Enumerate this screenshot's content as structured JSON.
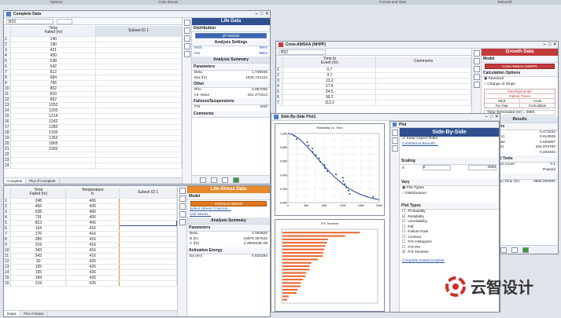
{
  "menubar": {
    "items": [
      "Options",
      "Folio Sheets",
      "",
      "Format and View",
      "ReliaSoft"
    ]
  },
  "win1": {
    "title": "Complete Data",
    "cell_ref": "B33",
    "headers": [
      "Time\nFailed (hr)",
      "Subset ID 1"
    ],
    "rows": [
      "140",
      "190",
      "421",
      "450",
      "538",
      "542",
      "612",
      "684",
      "706",
      "802",
      "810",
      "862",
      "1052",
      "1202",
      "1214",
      "1242",
      "1282",
      "1330",
      "1352",
      "1865",
      "2303"
    ],
    "tabs": [
      "Complete",
      "Plot of Complete"
    ],
    "panel": {
      "title": "Life Data",
      "distribution_label": "Distribution",
      "distribution": "2P-Weibull",
      "analysis_settings": "Analysis Settings",
      "opts": [
        "RRX",
        "RRY",
        "MLE",
        "FM",
        "MED"
      ],
      "opts_row1": [
        "RRX",
        "RRY"
      ],
      "opts_row2": [
        "FM",
        "MED"
      ],
      "summary": "Analysis Summary",
      "params": "Parameters",
      "kv": [
        [
          "Beta",
          "1.735945"
        ],
        [
          "Eta (hr)",
          "1026.721224"
        ]
      ],
      "other": "Other",
      "kv2": [
        [
          "Rho",
          "0.987065"
        ],
        [
          "LK Value",
          "-151.471814"
        ]
      ],
      "fs": "Failures/Suspensions",
      "fs_row": [
        "F/S",
        "20/0"
      ],
      "comments": "Comments"
    }
  },
  "win2": {
    "cell_ref": "B52",
    "headers": [
      "Time to\nEvent (hr)",
      "Comments"
    ],
    "rows": [
      "0.7",
      "3.7",
      "13.2",
      "17.6",
      "54.5",
      "99.2",
      "112.2"
    ],
    "panel": {
      "title": "Growth Data",
      "model_label": "Model",
      "model": "Crow-AMSAA (NHPP)",
      "calc": "Calculation Options",
      "opt1": "Standard",
      "opt2": "Change of Slope",
      "dev": "Developmental",
      "ft": "Failure Times",
      "grid": [
        "MLE",
        "Crow",
        "No Gap",
        "Cumulative"
      ],
      "term": "Time Terminated (hr) = 3860",
      "results": "Results",
      "params": "Parameters",
      "kv": [
        [
          "Beta",
          "0.472033"
        ],
        [
          "Lambda (hr)",
          "0.613926"
        ],
        [
          "Growth Rate",
          "0.526967"
        ],
        [
          "DMTBF (hr)",
          "284.976700"
        ],
        [
          "DFI",
          "0.003404"
        ]
      ],
      "stat": "Statistical Tests",
      "kv2": [
        [
          "Significance Level",
          "0.1"
        ],
        [
          "CVM",
          "Passed"
        ]
      ],
      "other": "Other",
      "term2": "Termination Time (hr)",
      "term2v": "3860.000000"
    }
  },
  "win3": {
    "title": "Life-Stress Data",
    "headers": [
      "Time\nFailed (hr)",
      "Temperature\nK",
      "Subset ID 1"
    ],
    "rows": [
      [
        "248",
        "406"
      ],
      [
        "456",
        "406"
      ],
      [
        "528",
        "406"
      ],
      [
        "731",
        "406"
      ],
      [
        "813",
        "406"
      ],
      [
        "164",
        "416"
      ],
      [
        "176",
        "416"
      ],
      [
        "289",
        "416"
      ],
      [
        "319",
        "416"
      ],
      [
        "343",
        "416"
      ],
      [
        "543",
        "416"
      ],
      [
        "92",
        "426"
      ],
      [
        "105",
        "426"
      ],
      [
        "155",
        "426"
      ],
      [
        "184",
        "426"
      ],
      [
        "219",
        "426"
      ]
    ],
    "tabs": [
      "Data1",
      "Plot of Data1"
    ],
    "panel": {
      "title": "Life-Stress Data",
      "model_label": "Model",
      "model": "Arrhenius-Weibull",
      "links": [
        "Select Stress Columns...",
        "Use Stress..."
      ],
      "summary": "Analysis Summary",
      "params": "Parameters",
      "kv": [
        [
          "Beta",
          "2.063820"
        ],
        [
          "B (K)",
          "10679.357542"
        ],
        [
          "C (hr)",
          "2.396615E-09"
        ]
      ],
      "act": "Activation Energy",
      "act_row": [
        "Ea (eV)",
        "0.920294"
      ]
    }
  },
  "win4": {
    "title": "Side-By-Side Plot1",
    "plot1": {
      "title": "Reliability vs. Time",
      "yvals": [
        "1.000",
        "0.800",
        "0.600",
        "0.400",
        "0.200",
        "0.000"
      ],
      "xvals": [
        "0",
        "400",
        "800",
        "1200",
        "1600",
        "2000"
      ]
    },
    "plot2": {
      "title": "F/S Timeline"
    },
    "panel": {
      "title": "Side-By-Side",
      "plot_tab": "Plot",
      "keep": "Keep Aspect Ratio",
      "conf": "Confidence Bounds...",
      "scaling": "Scaling",
      "x_label": "X",
      "x_min": "0",
      "x_max": "4000",
      "vary": "Vary",
      "vary_opts": [
        "Plot Types",
        "Distributions"
      ],
      "types_label": "Plot Types",
      "types": [
        "Probability",
        "Reliability",
        "Unreliability",
        "Pdf",
        "Failure Rate",
        "Contour",
        "F/S Histogram",
        "F/S Pie",
        "F/S Timeline"
      ],
      "types_checked": [
        false,
        true,
        false,
        false,
        false,
        false,
        false,
        false,
        true
      ],
      "link": "Complete Data\\Complete"
    }
  },
  "watermark": {
    "text": "云智设计"
  },
  "colors": {
    "blue_head": "#2f4f8f",
    "red_head": "#c23b3b",
    "orange_head": "#e8892a",
    "timeline": "#e8642a",
    "curve": "#1f3f8f"
  }
}
